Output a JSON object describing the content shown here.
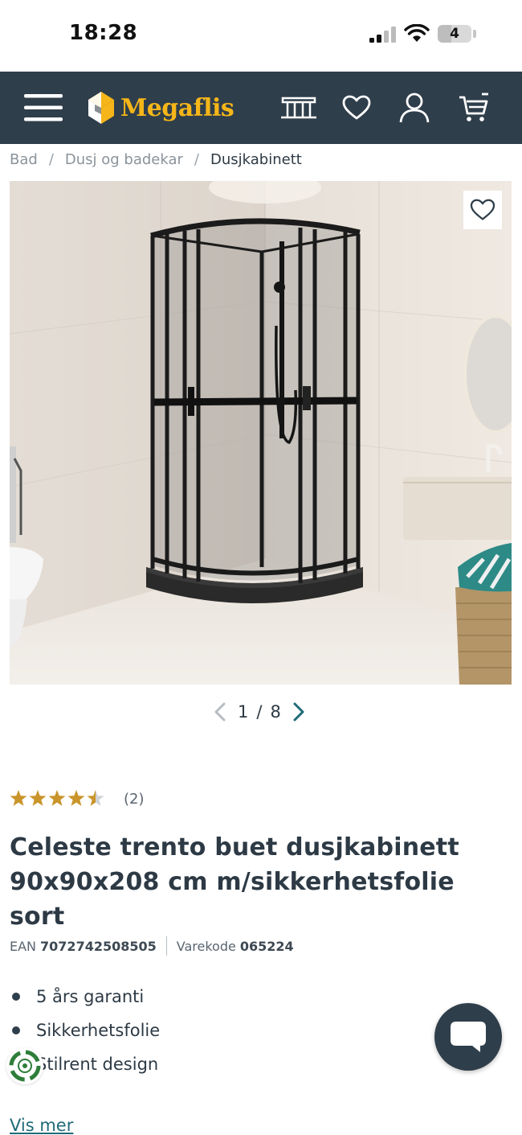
{
  "status_bar": {
    "time": "18:28",
    "battery": "4",
    "battery_fraction": 0.4
  },
  "header": {
    "logo_text": "Megaflis",
    "icons": [
      "menu-icon",
      "showroom-icon",
      "heart-icon",
      "user-icon",
      "cart-icon"
    ]
  },
  "breadcrumb": {
    "items": [
      "Bad",
      "Dusj og badekar"
    ],
    "current": "Dusjkabinett",
    "separator": "/"
  },
  "gallery": {
    "current": "1",
    "separator": "/",
    "total": "8"
  },
  "rating": {
    "value": 4.5,
    "max": 5,
    "count_text": "(2)"
  },
  "product": {
    "title": "Celeste trento buet dusjkabinett 90x90x208 cm m/sikkerhetsfolie sort",
    "ean_label": "EAN",
    "ean": "7072742508505",
    "code_label": "Varekode",
    "code": "065224",
    "bullets": [
      "5 års garanti",
      "Sikkerhetsfolie",
      "Stilrent design"
    ],
    "show_more": "Vis mer"
  },
  "colors": {
    "header_bg": "#2f3e4b",
    "logo_yellow": "#f6b619",
    "star_gold": "#c9952a",
    "link": "#1f6b78"
  }
}
